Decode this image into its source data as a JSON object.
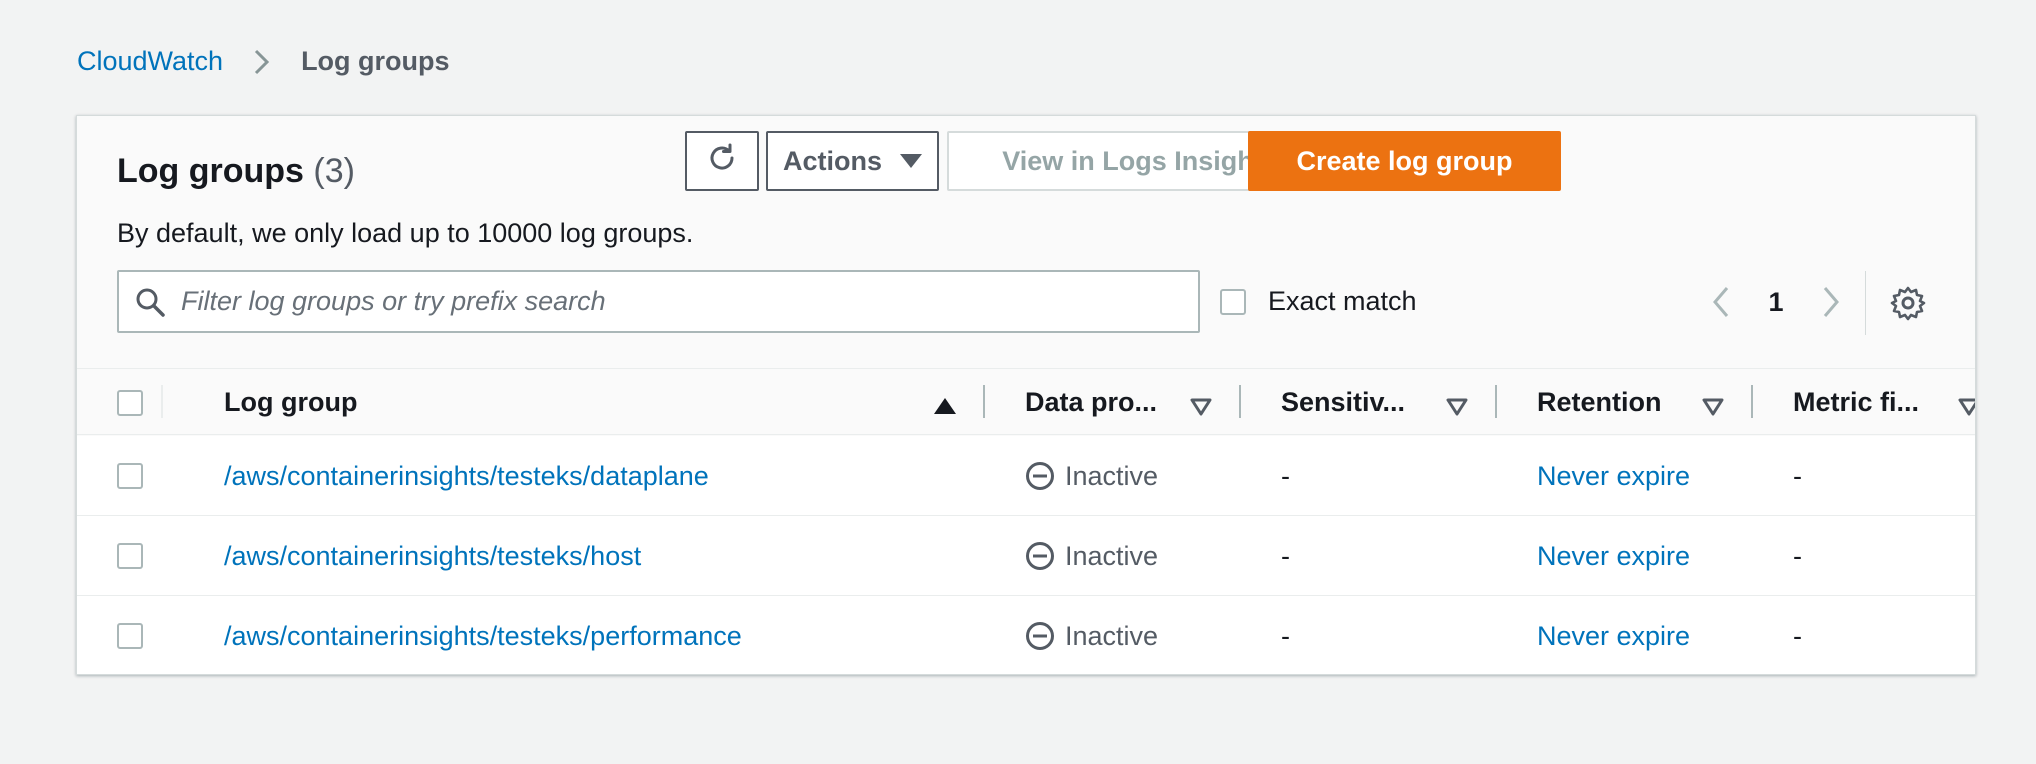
{
  "breadcrumb": {
    "root": "CloudWatch",
    "current": "Log groups"
  },
  "panel": {
    "title": "Log groups",
    "count": "(3)",
    "subtitle": "By default, we only load up to 10000 log groups."
  },
  "toolbar": {
    "refresh_icon": "refresh-icon",
    "actions_label": "Actions",
    "insights_label": "View in Logs Insights",
    "create_label": "Create log group"
  },
  "filter": {
    "placeholder": "Filter log groups or try prefix search",
    "value": "",
    "exact_match_label": "Exact match",
    "exact_match_checked": false
  },
  "pagination": {
    "current_page": "1"
  },
  "table": {
    "columns": [
      {
        "label": "Log group",
        "sort": "ascending"
      },
      {
        "label": "Data pro...",
        "sort": "none"
      },
      {
        "label": "Sensitiv...",
        "sort": "none"
      },
      {
        "label": "Retention",
        "sort": "none"
      },
      {
        "label": "Metric fi...",
        "sort": "none"
      }
    ],
    "rows": [
      {
        "log_group": "/aws/containerinsights/testeks/dataplane",
        "data_protection": "Inactive",
        "sensitive": "-",
        "retention": "Never expire",
        "metric_filters": "-"
      },
      {
        "log_group": "/aws/containerinsights/testeks/host",
        "data_protection": "Inactive",
        "sensitive": "-",
        "retention": "Never expire",
        "metric_filters": "-"
      },
      {
        "log_group": "/aws/containerinsights/testeks/performance",
        "data_protection": "Inactive",
        "sensitive": "-",
        "retention": "Never expire",
        "metric_filters": "-"
      }
    ]
  },
  "colors": {
    "link": "#0073bb",
    "primary_button": "#ec7211",
    "background": "#f2f3f3"
  }
}
